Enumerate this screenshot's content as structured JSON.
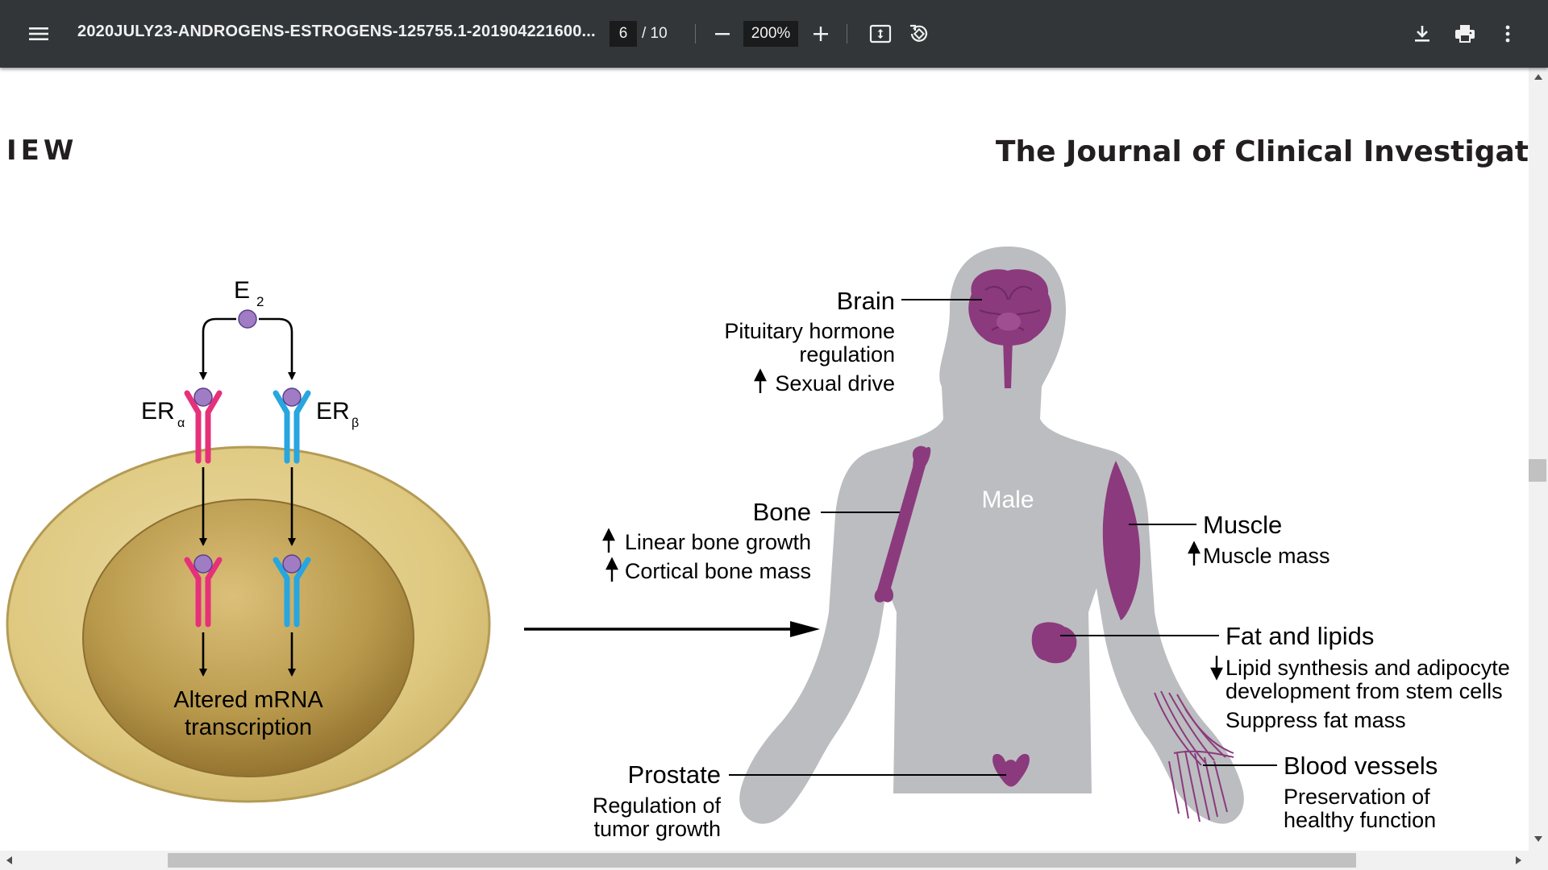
{
  "toolbar": {
    "title": "2020JULY23-ANDROGENS-ESTROGENS-125755.1-201904221600...",
    "current_page": "6",
    "total_pages": "/ 10",
    "zoom": "200%",
    "icons": [
      "menu-icon",
      "minus-icon",
      "plus-icon",
      "fit-page-icon",
      "rotate-icon",
      "download-icon",
      "print-icon",
      "more-vert-icon"
    ]
  },
  "page": {
    "header_left": "IEW",
    "header_right": "The Journal of Clinical Investigat",
    "cell": {
      "ligand": "E",
      "ligand_sub": "2",
      "receptor_alpha": "ER",
      "receptor_alpha_sub": "α",
      "receptor_beta": "ER",
      "receptor_beta_sub": "β",
      "nucleus_line1": "Altered mRNA",
      "nucleus_line2": "transcription"
    },
    "body": {
      "label": "Male",
      "brain_title": "Brain",
      "brain_line1": "Pituitary hormone",
      "brain_line2": "regulation",
      "brain_line3": "Sexual drive",
      "bone_title": "Bone",
      "bone_line1": "Linear bone growth",
      "bone_line2": "Cortical bone mass",
      "muscle_title": "Muscle",
      "muscle_line1": "Muscle mass",
      "fat_title": "Fat and lipids",
      "fat_line1": "Lipid synthesis and adipocyte",
      "fat_line2": "development from stem cells",
      "fat_line3": "Suppress fat mass",
      "prostate_title": "Prostate",
      "prostate_line1": "Regulation of",
      "prostate_line2": "tumor growth",
      "vessels_title": "Blood vessels",
      "vessels_line1": "Preservation of",
      "vessels_line2": "healthy function"
    }
  },
  "colors": {
    "toolbar_bg": "#323639",
    "er_alpha": "#e6317a",
    "er_beta": "#27a6df",
    "ligand": "#a07cc5",
    "organ": "#8b3a7e",
    "body": "#bcbdc0"
  }
}
